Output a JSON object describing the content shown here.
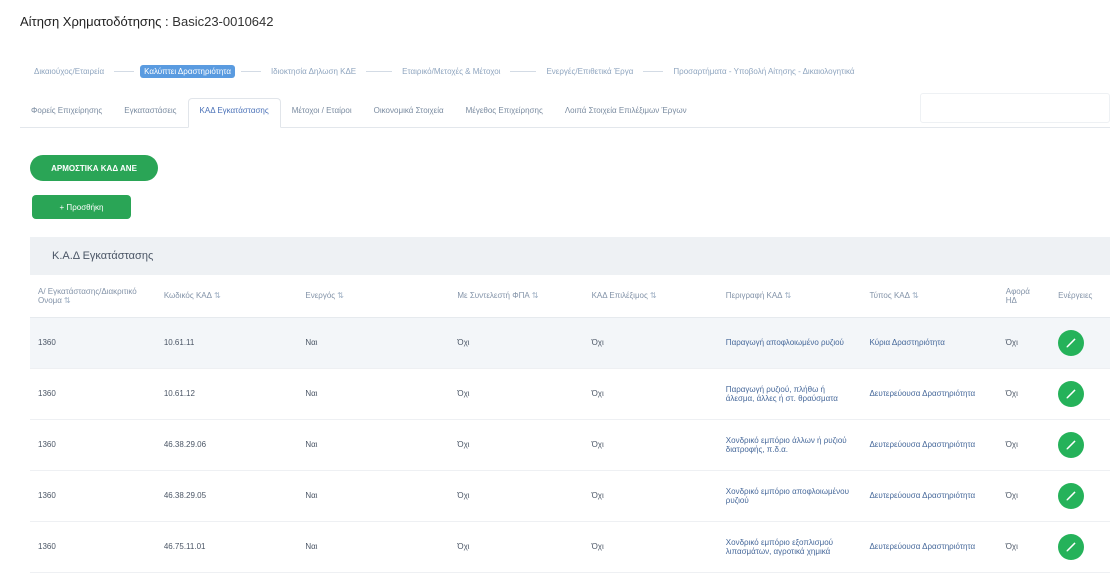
{
  "title": {
    "label": "Αίτηση Χρηματοδότησης :",
    "number": "Basic23-0010642"
  },
  "stepper": [
    {
      "label": "Δικαιούχος/Εταιρεία",
      "active": false
    },
    {
      "label": "Καλύπτει Δραστηριότητα",
      "active": true
    },
    {
      "label": "Ιδιοκτησία Δηλωση ΚΔΕ",
      "active": false
    },
    {
      "label": "Εταιρικό/Μετοχές & Μέτοχοι",
      "active": false
    },
    {
      "label": "Ενεργές/Επιθετικά Έργα",
      "active": false
    },
    {
      "label": "Προσαρτήματα - Υποβολή Αίτησης - Δικαιολογητικά",
      "active": false
    }
  ],
  "tabs": [
    {
      "label": "Φορείς Επιχείρησης",
      "active": false
    },
    {
      "label": "Εγκαταστάσεις",
      "active": false
    },
    {
      "label": "ΚΑΔ Εγκατάστασης",
      "active": true
    },
    {
      "label": "Μέτοχοι / Εταίροι",
      "active": false
    },
    {
      "label": "Οικονομικά Στοιχεία",
      "active": false
    },
    {
      "label": "Μέγεθος Επιχείρησης",
      "active": false
    },
    {
      "label": "Λοιπά Στοιχεία Επιλέξιμων Έργων",
      "active": false
    }
  ],
  "buttons": {
    "apply": "ΑΡΜΟΣΤΙΚΑ ΚΑΔ ΑΝΕ",
    "add": "+ Προσθήκη"
  },
  "panel": {
    "title": "Κ.Α.Δ Εγκατάστασης"
  },
  "table": {
    "columns": [
      "Α/ Εγκατάστασης/Διακριτικό Ονομα",
      "Κωδικός ΚΑΔ",
      "Ενεργός",
      "Με Συντελεστή ΦΠΑ",
      "ΚΑΔ Επιλέξιμος",
      "Περιγραφή ΚΑΔ",
      "Τύπος ΚΑΔ",
      "Αφορά ΗΔ",
      "Ενέργειες"
    ],
    "rows": [
      {
        "c1": "1360",
        "c2": "10.61.11",
        "c3": "Ναι",
        "c4": "Όχι",
        "c5": "Όχι",
        "c6": "Παραγωγή αποφλοιωμένο ρυζιού",
        "c7": "Κύρια Δραστηριότητα",
        "c8": "Όχι"
      },
      {
        "c1": "1360",
        "c2": "10.61.12",
        "c3": "Ναι",
        "c4": "Όχι",
        "c5": "Όχι",
        "c6": "Παραγωγή ρυζιού, πλήθω ή άλεσμα, άλλες ή στ. θραύσματα",
        "c7": "Δευτερεύουσα Δραστηριότητα",
        "c8": "Όχι"
      },
      {
        "c1": "1360",
        "c2": "46.38.29.06",
        "c3": "Ναι",
        "c4": "Όχι",
        "c5": "Όχι",
        "c6": "Χονδρικό εμπόριο άλλων ή ρυζιού διατροφής, π.δ.α.",
        "c7": "Δευτερεύουσα Δραστηριότητα",
        "c8": "Όχι"
      },
      {
        "c1": "1360",
        "c2": "46.38.29.05",
        "c3": "Ναι",
        "c4": "Όχι",
        "c5": "Όχι",
        "c6": "Χονδρικό εμπόριο αποφλοιωμένου ρυζιού",
        "c7": "Δευτερεύουσα Δραστηριότητα",
        "c8": "Όχι"
      },
      {
        "c1": "1360",
        "c2": "46.75.11.01",
        "c3": "Ναι",
        "c4": "Όχι",
        "c5": "Όχι",
        "c6": "Χονδρικό εμπόριο εξοπλισμού λιπασμάτων, αγροτικά χημικά",
        "c7": "Δευτερεύουσα Δραστηριότητα",
        "c8": "Όχι"
      }
    ]
  }
}
